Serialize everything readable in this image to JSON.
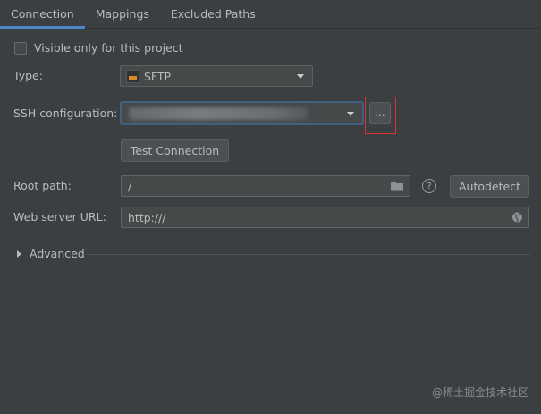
{
  "tabs": [
    {
      "label": "Connection",
      "active": true
    },
    {
      "label": "Mappings",
      "active": false
    },
    {
      "label": "Excluded Paths",
      "active": false
    }
  ],
  "visible_only": {
    "label": "Visible only for this project",
    "checked": false
  },
  "type": {
    "label": "Type:",
    "value": "SFTP",
    "icon": "sftp-icon"
  },
  "ssh": {
    "label": "SSH configuration:",
    "value": "",
    "browse_label": "..."
  },
  "test_connection": {
    "label": "Test Connection"
  },
  "root_path": {
    "label": "Root path:",
    "value": "/",
    "autodetect_label": "Autodetect"
  },
  "web_server_url": {
    "label": "Web server URL:",
    "value": "http:///"
  },
  "advanced": {
    "label": "Advanced",
    "expanded": false
  },
  "watermark": "@稀土掘金技术社区",
  "colors": {
    "accent": "#4a88c7",
    "highlight": "#d9323a",
    "background": "#3c3f41"
  }
}
